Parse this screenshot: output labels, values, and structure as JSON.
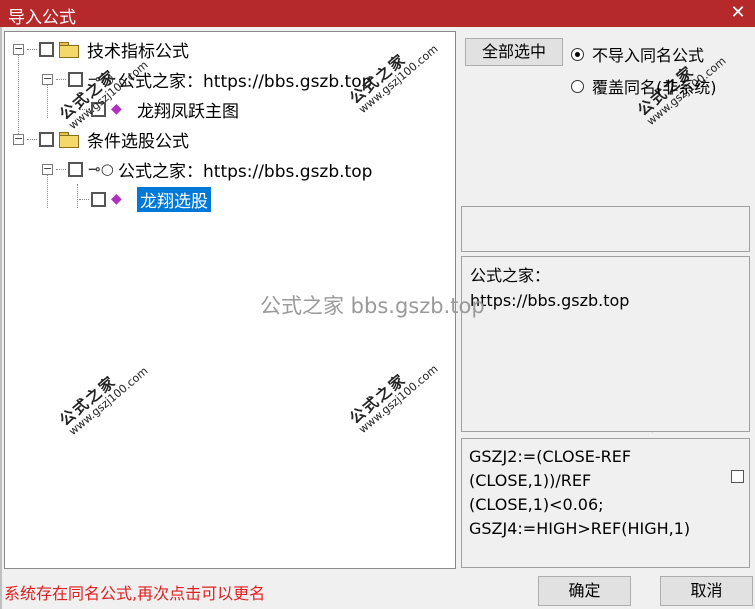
{
  "window": {
    "title": "导入公式",
    "close_glyph": "✕"
  },
  "tree": {
    "nodes": [
      {
        "label": "技术指标公式"
      },
      {
        "label": "公式之家：https://bbs.gszb.top"
      },
      {
        "label": "龙翔凤跃主图"
      },
      {
        "label": "条件选股公式"
      },
      {
        "label": "公式之家：https://bbs.gszb.top"
      },
      {
        "label": "龙翔选股",
        "selected": true
      }
    ],
    "expander_glyph": "−",
    "key_glyph": "⊸○",
    "gem_glyph": "◆"
  },
  "watermarks": {
    "site_name": "公式之家",
    "site_url": "www.gszj100.com",
    "center_text": "公式之家 bbs.gszb.top"
  },
  "options": {
    "select_all_label": "全部选中",
    "radio_no_import": "不导入同名公式",
    "radio_overwrite": "覆盖同名(非系统)",
    "selected_radio": "no_import"
  },
  "info": {
    "line1": "公式之家：",
    "line2": "https://bbs.gszb.top"
  },
  "code": {
    "line1": "GSZJ2:=(CLOSE-REF",
    "line2": "(CLOSE,1))/REF",
    "line3": "(CLOSE,1)<0.06;",
    "line4": "GSZJ4:=HIGH>REF(HIGH,1)"
  },
  "footer": {
    "status": "系统存在同名公式,再次点击可以更名",
    "ok_label": "确定",
    "cancel_label": "取消"
  },
  "colors": {
    "titlebar": "#b6292b",
    "selection": "#0078d7",
    "status_text": "#e02020"
  }
}
